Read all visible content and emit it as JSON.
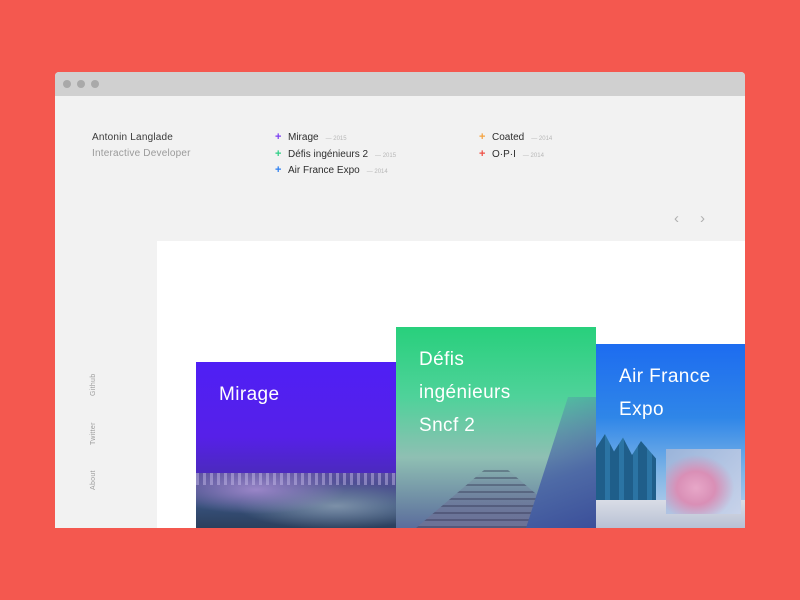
{
  "author": {
    "name": "Antonin Langlade",
    "role": "Interactive Developer"
  },
  "projects": [
    {
      "name": "Mirage",
      "year": "— 2015",
      "color": "#7b3ff2"
    },
    {
      "name": "Défis ingénieurs 2",
      "year": "— 2015",
      "color": "#2fcf86"
    },
    {
      "name": "Air France Expo",
      "year": "— 2014",
      "color": "#2d7ff0"
    },
    {
      "name": "Coated",
      "year": "— 2014",
      "color": "#f4a340"
    },
    {
      "name": "O·P·I",
      "year": "— 2014",
      "color": "#ee4f45"
    }
  ],
  "plus_glyph": "+",
  "nav": {
    "prev": "‹",
    "next": "›"
  },
  "social": [
    "Github",
    "Twitter",
    "About"
  ],
  "cards": [
    {
      "lines": [
        "Mirage"
      ],
      "colors": [
        "#4f1ff5",
        "#3d3f96"
      ]
    },
    {
      "lines": [
        "Défis",
        "ingénieurs",
        "Sncf 2"
      ],
      "colors": [
        "#28d07c",
        "#5b6d9c"
      ]
    },
    {
      "lines": [
        "Air France",
        "Expo"
      ],
      "colors": [
        "#1d6cf0",
        "#c8d6ea"
      ]
    }
  ],
  "colors": {
    "background": "#f4584f",
    "window": "#f2f2f2",
    "titlebar": "#d0d0d0"
  }
}
